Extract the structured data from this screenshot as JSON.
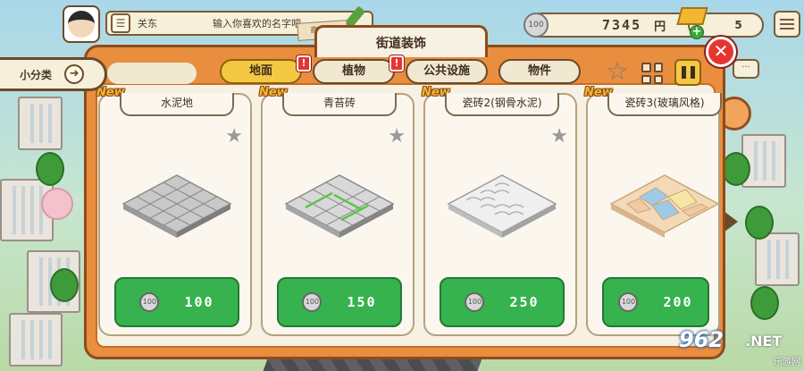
{
  "player": {
    "name": "关东",
    "name_placeholder": "输入你喜欢的名字吧"
  },
  "currency": {
    "coins": "7345",
    "coin_unit": "円",
    "coin_icon_text": "100",
    "gold": "5"
  },
  "shop_tag": "商店街",
  "panel": {
    "title": "街道装饰"
  },
  "sub_category": {
    "label": "小分类"
  },
  "categories": [
    {
      "label": "地面",
      "active": true,
      "alert": true
    },
    {
      "label": "植物",
      "active": false,
      "alert": true
    },
    {
      "label": "公共设施",
      "active": false,
      "alert": false
    },
    {
      "label": "物件",
      "active": false,
      "alert": false
    }
  ],
  "alert_mark": "!",
  "new_badge": "New",
  "items": [
    {
      "name": "水泥地",
      "price": "100",
      "tile": "cement"
    },
    {
      "name": "青苔砖",
      "price": "150",
      "tile": "moss"
    },
    {
      "name": "瓷砖2(钢骨水泥)",
      "price": "250",
      "tile": "ceramic"
    },
    {
      "name": "瓷砖3(玻璃风格)",
      "price": "200",
      "tile": "glass"
    }
  ],
  "icons": [
    "list-icon",
    "coin-icon",
    "gold-bar-icon",
    "plus-icon",
    "menu-icon",
    "close-icon",
    "star-icon",
    "grid-icon",
    "pause-icon",
    "arrow-right-icon",
    "chat-icon",
    "wheel-icon"
  ],
  "colors": {
    "panel_orange": "#e98d3f",
    "price_green": "#36b34f",
    "active_tab": "#f4c842",
    "close_red": "#e8342f"
  },
  "watermark": {
    "logo": "962",
    "net": ".NET",
    "sub": "乐游网"
  }
}
